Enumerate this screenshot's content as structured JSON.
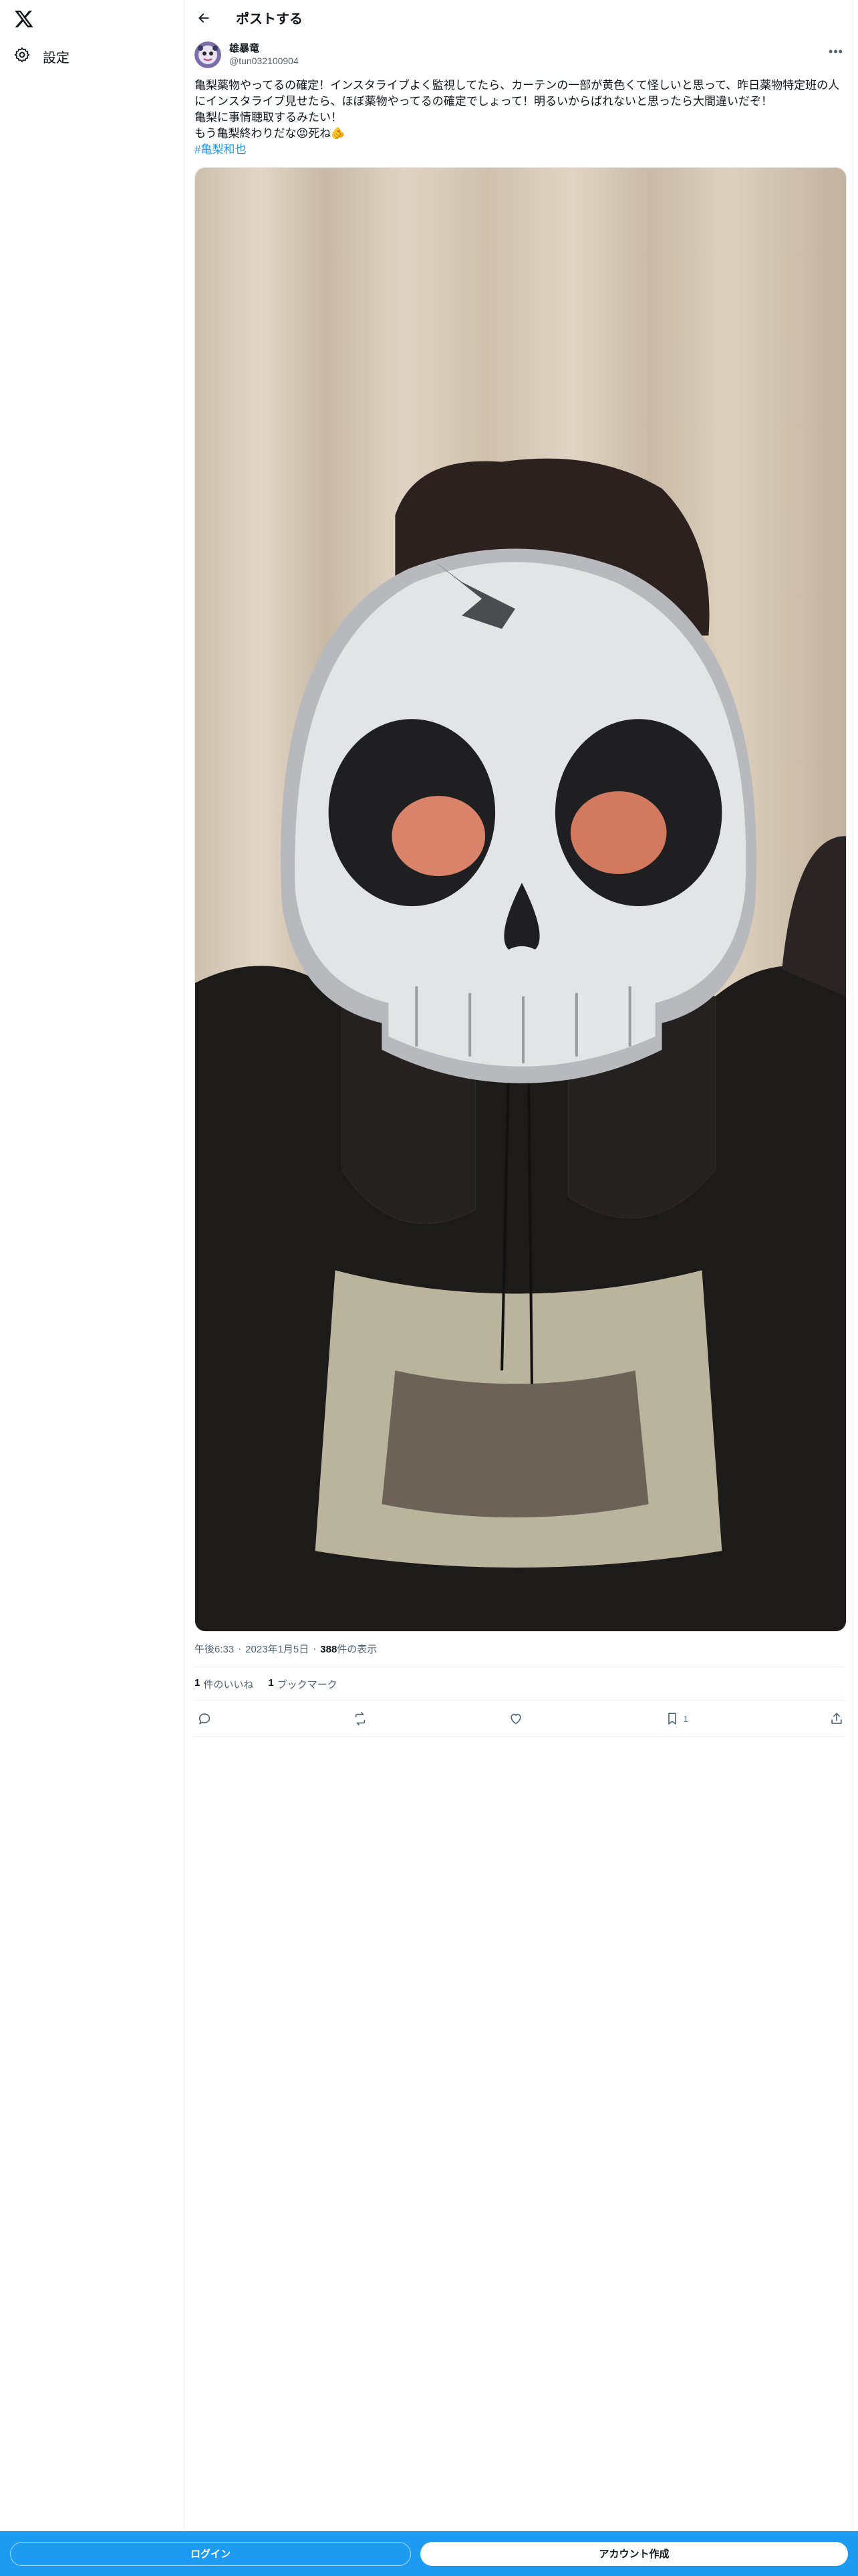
{
  "nav": {
    "logo_icon": "x-logo-icon",
    "settings_label": "設定"
  },
  "header": {
    "title": "ポストする"
  },
  "post": {
    "display_name": "雄暴竜",
    "handle": "@tun032100904",
    "more_icon": "more-dots-icon",
    "text_line1": "亀梨薬物やってるの確定！インスタライブよく監視してたら、カーテンの一部が黄色くて怪しいと思って、昨日薬物特定班の人にインスタライブ見せたら、ほぼ薬物やってるの確定でしょって！明るいからばれないと思ったら大間違いだぞ！",
    "text_line2": "亀梨に事情聴取するみたい！",
    "text_line3": "もう亀梨終わりだな😡死ね🫵",
    "hashtag": "#亀梨和也",
    "time": "午後6:33",
    "date": "2023年1月5日",
    "views_count": "388",
    "views_label": "件の表示",
    "separator": "·",
    "likes_count": "1",
    "likes_label": "件のいいね",
    "bookmarks_count": "1",
    "bookmarks_label": "ブックマーク",
    "bookmark_action_count": "1"
  },
  "actions": {
    "reply_icon": "reply-icon",
    "repost_icon": "repost-icon",
    "like_icon": "heart-icon",
    "bookmark_icon": "bookmark-icon",
    "share_icon": "share-icon"
  },
  "bottom_bar": {
    "login_label": "ログイン",
    "signup_label": "アカウント作成"
  },
  "colors": {
    "accent": "#1d9bf0",
    "text": "#0f1419",
    "muted": "#536471"
  }
}
